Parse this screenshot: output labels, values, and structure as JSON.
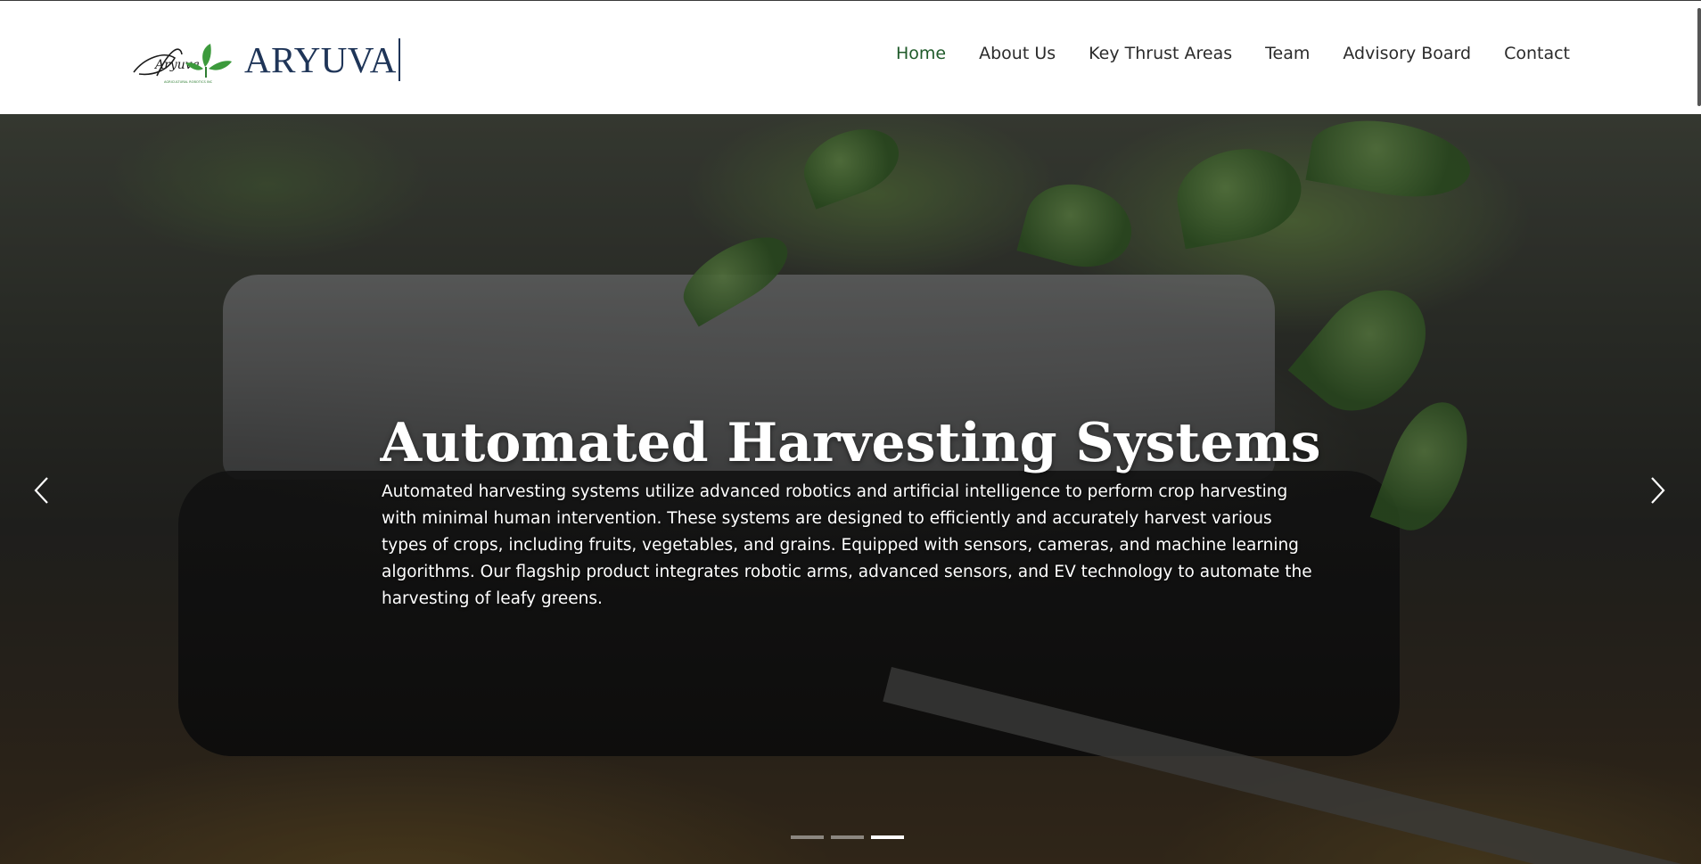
{
  "brand": {
    "name": "ARYUVA",
    "logo_script": "Aryuva",
    "logo_tagline": "AGRICULTURAL ROBOTICS INC"
  },
  "nav": {
    "items": [
      {
        "label": "Home",
        "active": true
      },
      {
        "label": "About Us",
        "active": false
      },
      {
        "label": "Key Thrust Areas",
        "active": false
      },
      {
        "label": "Team",
        "active": false
      },
      {
        "label": "Advisory Board",
        "active": false
      },
      {
        "label": "Contact",
        "active": false
      }
    ]
  },
  "hero": {
    "title": "Automated Harvesting Systems",
    "description": "Automated harvesting systems utilize advanced robotics and artificial intelligence to perform crop harvesting with minimal human intervention. These systems are designed to efficiently and accurately harvest various types of crops, including fruits, vegetables, and grains. Equipped with sensors, cameras, and machine learning algorithms. Our flagship product integrates robotic arms, advanced sensors, and EV technology to automate the harvesting of leafy greens.",
    "prev_icon": "chevron-left-icon",
    "next_icon": "chevron-right-icon",
    "slides_total": 3,
    "active_slide": 3
  },
  "colors": {
    "brand_navy": "#1f3558",
    "brand_green": "#2e7d32",
    "nav_active": "#1f5a2a",
    "nav_text": "#2b2b2b"
  }
}
